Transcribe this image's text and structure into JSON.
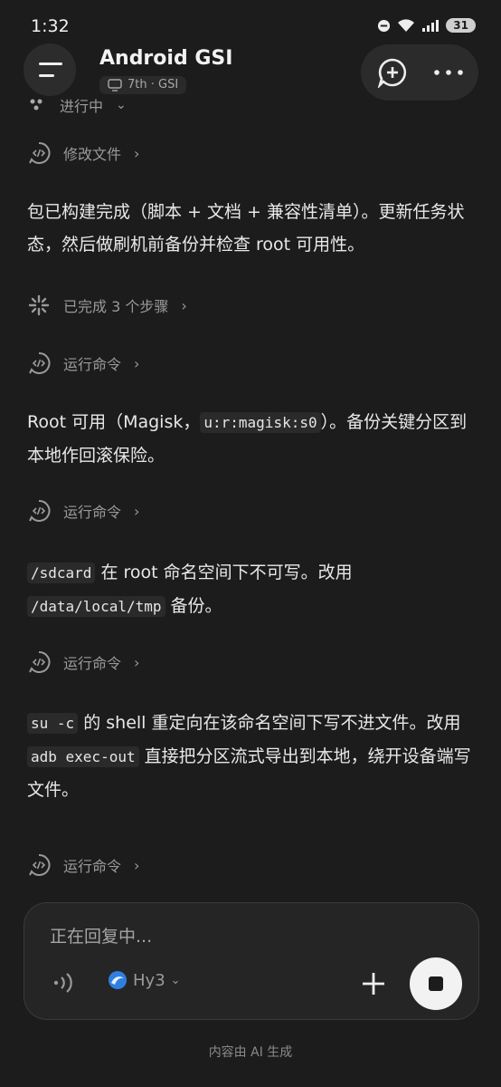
{
  "status_bar": {
    "time": "1:32",
    "battery": "31"
  },
  "header": {
    "title": "Android GSI",
    "tag": "7th · GSI"
  },
  "progress_label": "进行中",
  "steps": {
    "edit_file": "修改文件",
    "completed": "已完成 3 个步骤",
    "run_cmd_1": "运行命令",
    "run_cmd_2": "运行命令",
    "run_cmd_3": "运行命令",
    "run_cmd_4": "运行命令"
  },
  "messages": {
    "m1": "包已构建完成（脚本 + 文档 + 兼容性清单）。更新任务状态，然后做刷机前备份并检查 root 可用性。",
    "m2": {
      "a": "Root 可用（Magisk，",
      "code": "u:r:magisk:s0",
      "b": "）。备份关键分区到本地作回滚保险。"
    },
    "m3": {
      "code1": "/sdcard",
      "a": " 在 root 命名空间下不可写。改用 ",
      "code2": "/data/local/tmp",
      "b": " 备份。"
    },
    "m4": {
      "code1": "su -c",
      "a": " 的 shell 重定向在该命名空间下写不进文件。改用 ",
      "code2": "adb exec-out",
      "b": " 直接把分区流式导出到本地，绕开设备端写文件。"
    }
  },
  "composer": {
    "placeholder": "正在回复中...",
    "model": "Hy3"
  },
  "footer": "内容由 AI 生成",
  "colors": {
    "background": "#1c1c1c",
    "text": "#e6e6e6",
    "muted": "#9a9a9a"
  }
}
